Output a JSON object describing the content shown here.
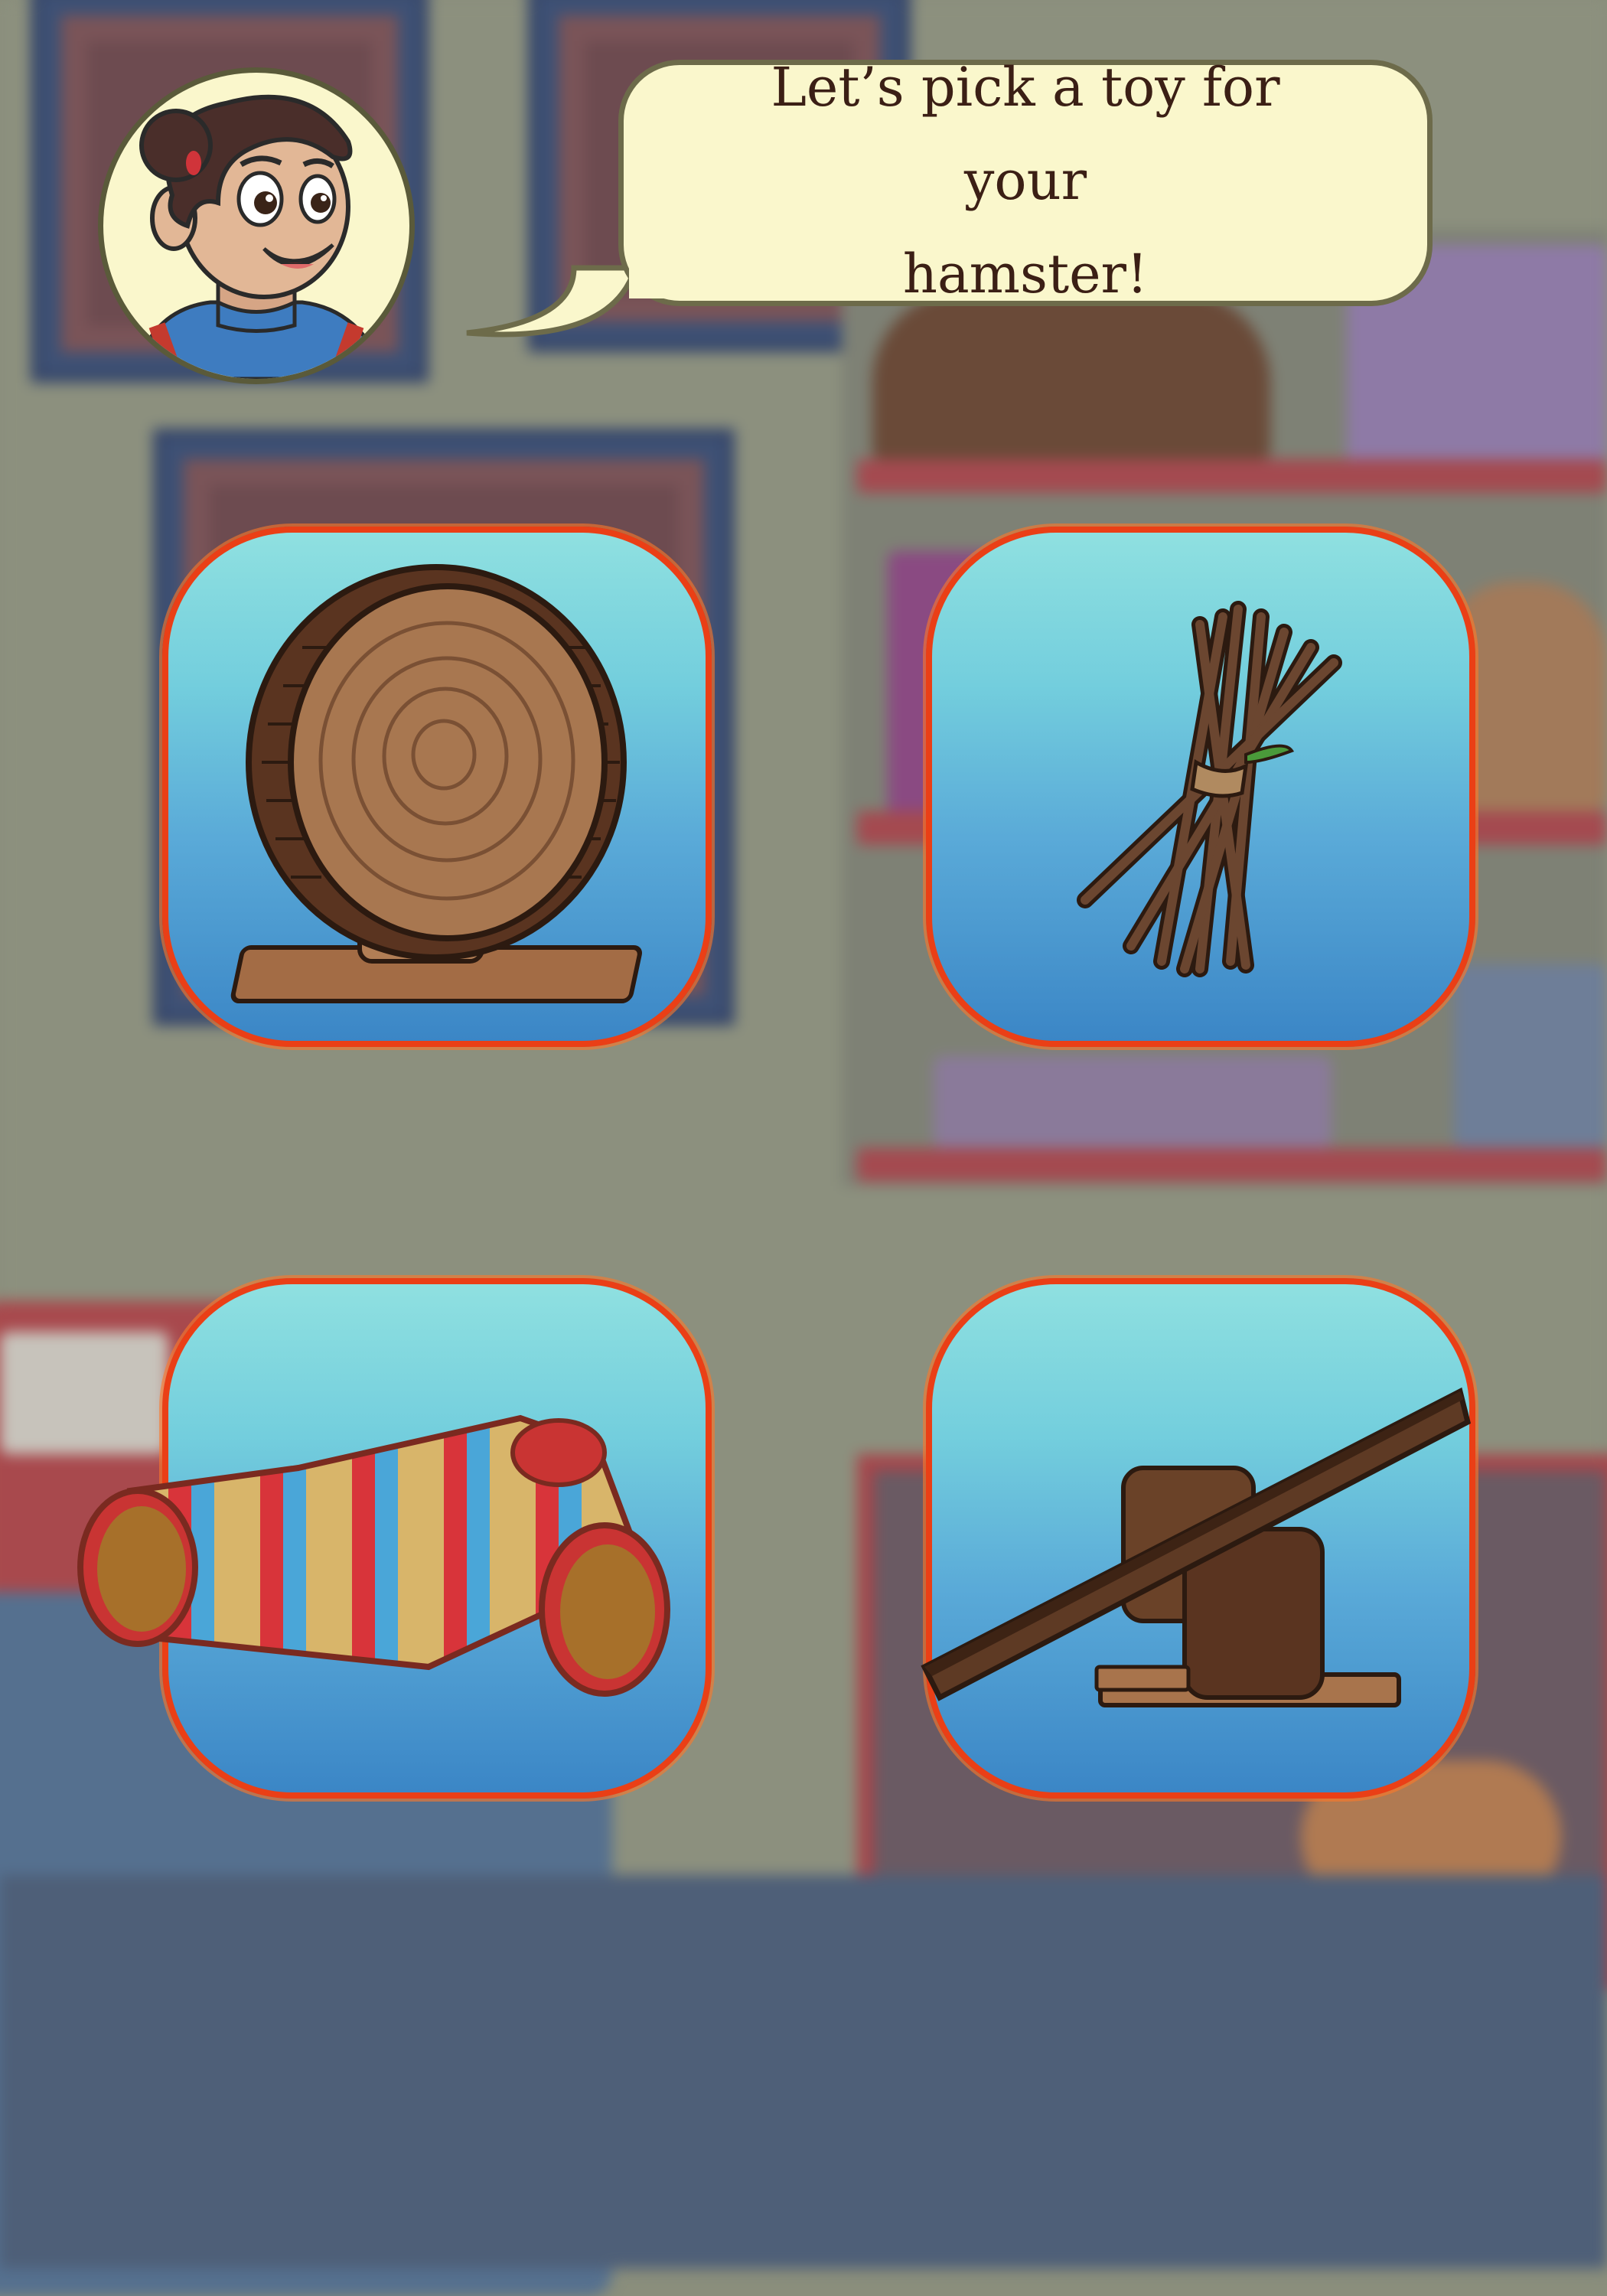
{
  "dialog": {
    "speaker": "girl-avatar",
    "line1": "Let’s pick a toy for your",
    "line2": "hamster!"
  },
  "toys": [
    {
      "id": "wheel",
      "icon": "wooden-wheel-icon"
    },
    {
      "id": "sticks",
      "icon": "chew-sticks-icon"
    },
    {
      "id": "tunnel",
      "icon": "tunnel-icon"
    },
    {
      "id": "seesaw",
      "icon": "seesaw-icon"
    }
  ],
  "colors": {
    "card_border": "#ea3f16",
    "card_top": "#8fe0e0",
    "card_bottom": "#3b86c6",
    "bubble": "#faf7cc",
    "text": "#3b1f15"
  }
}
